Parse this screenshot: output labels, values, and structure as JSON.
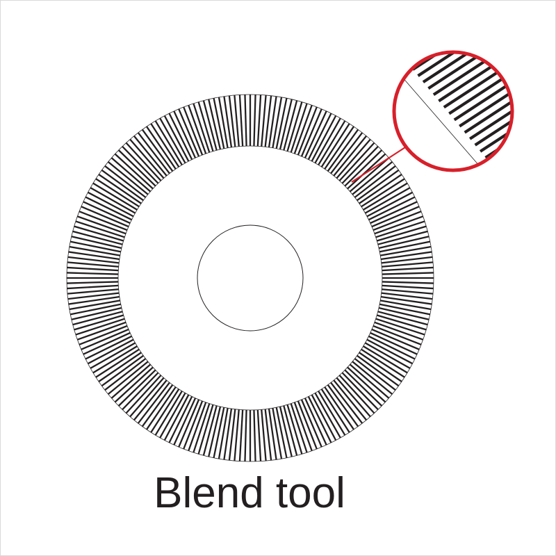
{
  "caption": "Blend tool",
  "colors": {
    "background": "#ffffff",
    "stroke": "#231f20",
    "callout": "#d7202a"
  },
  "icons": {
    "ring": "blend-ring-icon",
    "magnifier": "zoom-callout-icon"
  }
}
